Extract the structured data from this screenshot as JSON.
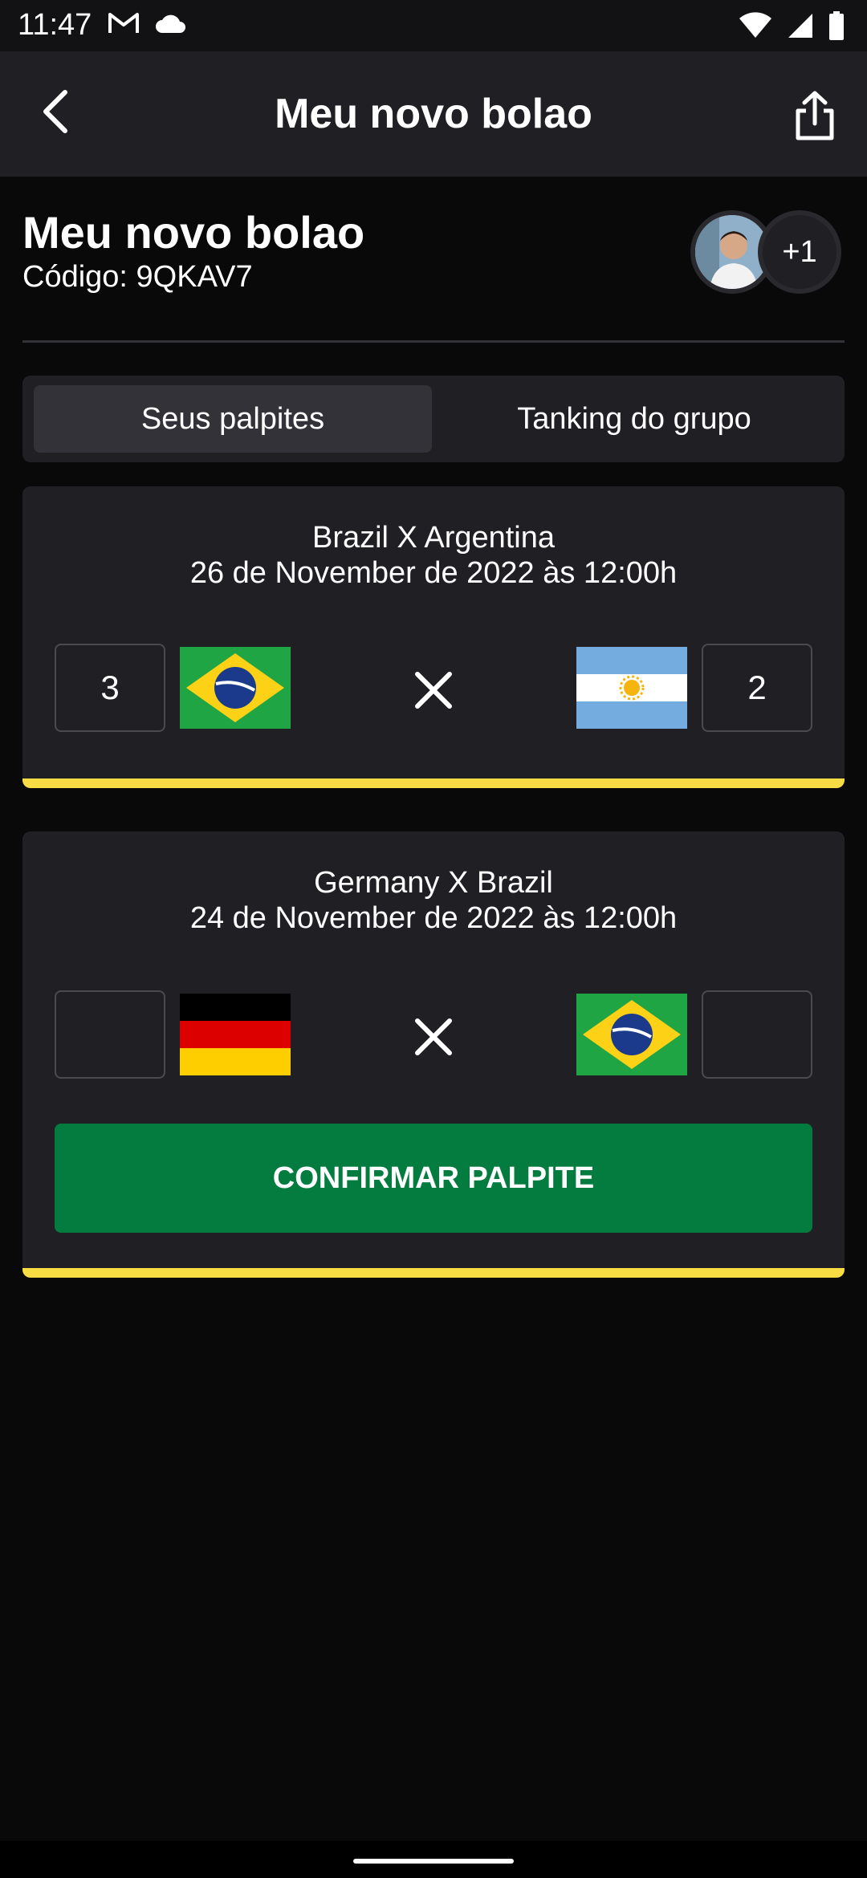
{
  "status_bar": {
    "time": "11:47",
    "icons_left": [
      "gmail-icon",
      "cloud-icon"
    ],
    "icons_right": [
      "wifi-icon",
      "signal-icon",
      "battery-icon"
    ]
  },
  "header": {
    "title": "Meu novo bolao",
    "back_icon": "chevron-left-icon",
    "share_icon": "share-icon"
  },
  "pool": {
    "name": "Meu novo bolao",
    "code": "Código: 9QKAV7",
    "extra_participants": "+1"
  },
  "tabs": [
    {
      "label": "Seus palpites",
      "active": true
    },
    {
      "label": "Tanking do grupo",
      "active": false
    }
  ],
  "matches": [
    {
      "title": "Brazil X Argentina",
      "date": "26 de November de 2022 às 12:00h",
      "home_team": "Brazil",
      "away_team": "Argentina",
      "home_score": "3",
      "away_score": "2"
    },
    {
      "title": "Germany X Brazil",
      "date": "24 de November de 2022 às 12:00h",
      "home_team": "Germany",
      "away_team": "Brazil",
      "home_score": "",
      "away_score": "",
      "confirm_label": "CONFIRMAR PALPITE"
    }
  ],
  "colors": {
    "background": "#09090A",
    "card": "#202024",
    "accent_yellow": "#F7DD43",
    "confirm_green": "#047C3F"
  }
}
